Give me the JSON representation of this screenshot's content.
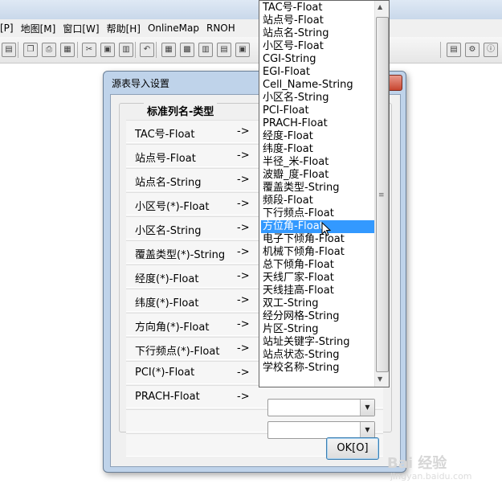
{
  "menu": [
    "[P]",
    "地图[M]",
    "窗口[W]",
    "帮助[H]",
    "OnlineMap",
    "RNOH"
  ],
  "dialog": {
    "title": "源表导入设置",
    "group_label": "标准列名-类型",
    "arrow": "->",
    "rows": [
      "TAC号-Float",
      "站点号-Float",
      "站点名-String",
      "小区号(*)-Float",
      "小区名-String",
      "覆盖类型(*)-String",
      "经度(*)-Float",
      "纬度(*)-Float",
      "方向角(*)-Float",
      "下行频点(*)-Float",
      "PCI(*)-Float",
      "PRACH-Float"
    ],
    "ok_label": "OK[O]"
  },
  "dropdown": {
    "selected_index": 17,
    "items": [
      "TAC号-Float",
      "站点号-Float",
      "站点名-String",
      "小区号-Float",
      "CGI-String",
      "EGI-Float",
      "Cell_Name-String",
      "小区名-String",
      "PCI-Float",
      "PRACH-Float",
      "经度-Float",
      "纬度-Float",
      "半径_米-Float",
      "波瓣_度-Float",
      "覆盖类型-String",
      "频段-Float",
      "下行频点-Float",
      "方位角-Float",
      "电子下倾角-Float",
      "机械下倾角-Float",
      "总下倾角-Float",
      "天线厂家-Float",
      "天线挂高-Float",
      "双工-String",
      "经分网格-String",
      "片区-String",
      "站址关键字-String",
      "站点状态-String",
      "学校名称-String"
    ]
  },
  "watermark": {
    "main": "Bai 经验",
    "sub": "jingyan.baidu.com"
  },
  "colors": {
    "selection": "#3399ff",
    "dialog_frame": "#bfd3ea"
  }
}
